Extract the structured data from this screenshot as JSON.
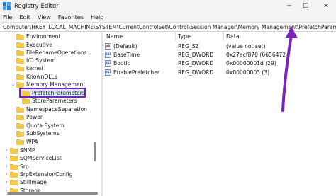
{
  "window": {
    "title": "Registry Editor",
    "minimize_glyph": "─",
    "maximize_glyph": "☐",
    "close_glyph": "✕"
  },
  "menu": [
    "File",
    "Edit",
    "View",
    "Favorites",
    "Help"
  ],
  "address": "Computer\\HKEY_LOCAL_MACHINE\\SYSTEM\\CurrentControlSet\\Control\\Session Manager\\Memory Management\\PrefetchParameters",
  "tree": [
    {
      "label": "Environment",
      "expander": ""
    },
    {
      "label": "Executive",
      "expander": ""
    },
    {
      "label": "FileRenameOperations",
      "expander": ""
    },
    {
      "label": "I/O System",
      "expander": ""
    },
    {
      "label": "kernel",
      "expander": ""
    },
    {
      "label": "KnownDLLs",
      "expander": ""
    },
    {
      "label": "Memory Management",
      "expander": "⌄"
    },
    {
      "label": "PrefetchParameters",
      "expander": "",
      "selected": true
    },
    {
      "label": "StoreParameters",
      "expander": ""
    },
    {
      "label": "NamespaceSeparation",
      "expander": ""
    },
    {
      "label": "Power",
      "expander": ""
    },
    {
      "label": "Quota System",
      "expander": ""
    },
    {
      "label": "SubSystems",
      "expander": ""
    },
    {
      "label": "WPA",
      "expander": ""
    },
    {
      "label": "SNMP",
      "expander": "›"
    },
    {
      "label": "SQMServiceList",
      "expander": "›"
    },
    {
      "label": "Srp",
      "expander": "›"
    },
    {
      "label": "SrpExtensionConfig",
      "expander": "›"
    },
    {
      "label": "StillImage",
      "expander": "›"
    },
    {
      "label": "Storage",
      "expander": "›"
    }
  ],
  "columns": {
    "name": "Name",
    "type": "Type",
    "data": "Data"
  },
  "values": [
    {
      "icon": "ab",
      "name": "(Default)",
      "type": "REG_SZ",
      "data": "(value not set)"
    },
    {
      "icon": "011",
      "name": "BaseTime",
      "type": "REG_DWORD",
      "data": "0x27acf870 (6656472"
    },
    {
      "icon": "011",
      "name": "BootId",
      "type": "REG_DWORD",
      "data": "0x00000001d (29)"
    },
    {
      "icon": "011",
      "name": "EnablePrefetcher",
      "type": "REG_DWORD",
      "data": "0x00000003 (3)"
    }
  ],
  "colors": {
    "highlight_border": "#7b23b8",
    "arrow": "#7b23b8",
    "selection": "#d9e8fb",
    "folder": "#f4c84a"
  },
  "icons": {
    "app": "registry-editor-icon",
    "folder": "folder-icon",
    "string_value": "reg-sz-icon",
    "dword_value": "reg-dword-icon"
  }
}
